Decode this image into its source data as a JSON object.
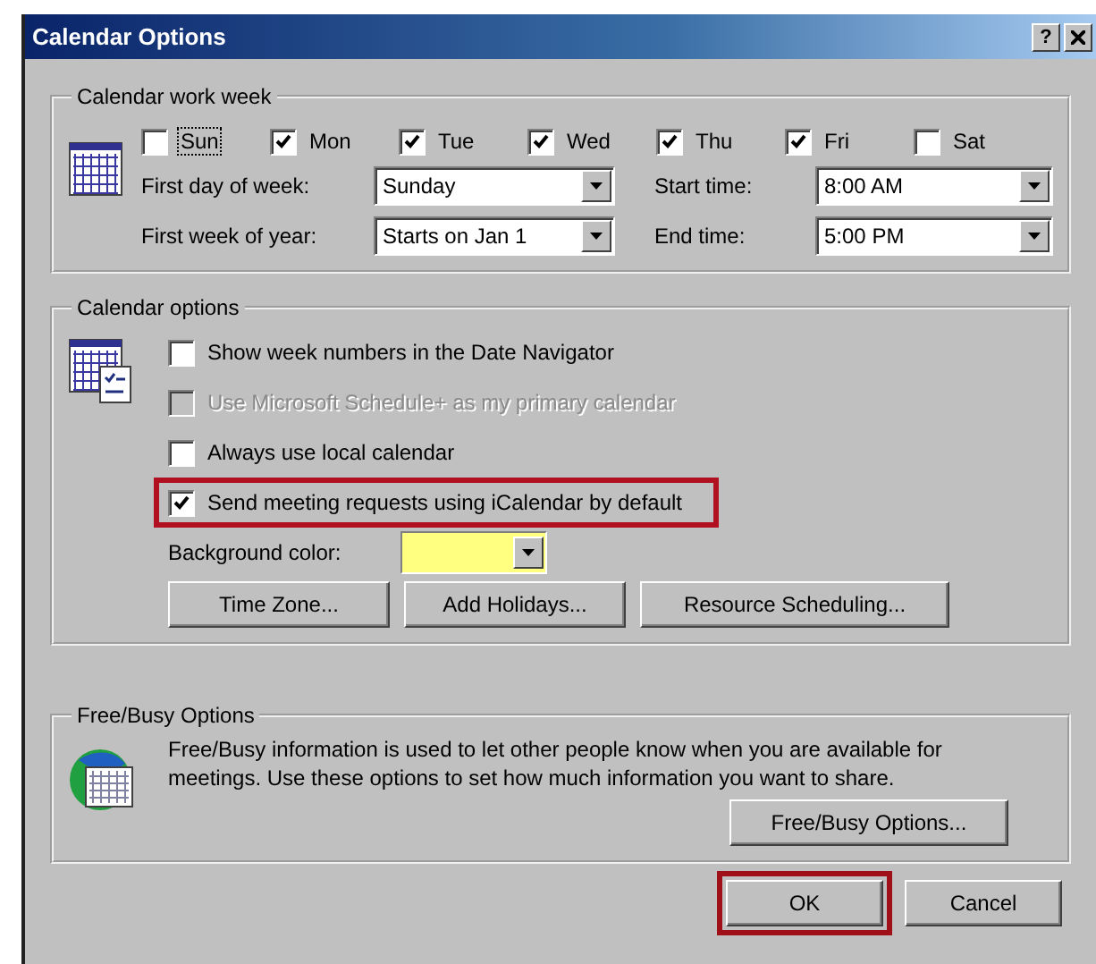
{
  "window": {
    "title": "Calendar Options",
    "help": "?"
  },
  "work_week": {
    "label": "Calendar work week",
    "days": [
      {
        "label": "Sun",
        "checked": false,
        "focused": true
      },
      {
        "label": "Mon",
        "checked": true,
        "focused": false
      },
      {
        "label": "Tue",
        "checked": true,
        "focused": false
      },
      {
        "label": "Wed",
        "checked": true,
        "focused": false
      },
      {
        "label": "Thu",
        "checked": true,
        "focused": false
      },
      {
        "label": "Fri",
        "checked": true,
        "focused": false
      },
      {
        "label": "Sat",
        "checked": false,
        "focused": false
      }
    ],
    "fields": [
      {
        "label": "First day of week:",
        "value": "Sunday"
      },
      {
        "label": "Start time:",
        "value": "8:00 AM"
      },
      {
        "label": "First week of year:",
        "value": "Starts on Jan 1"
      },
      {
        "label": "End time:",
        "value": "5:00 PM"
      }
    ]
  },
  "calendar_options": {
    "label": "Calendar options",
    "checkboxes": [
      {
        "label": "Show week numbers in the Date Navigator",
        "checked": false,
        "disabled": false,
        "highlighted": false
      },
      {
        "label": "Use Microsoft Schedule+ as my primary calendar",
        "checked": false,
        "disabled": true,
        "highlighted": false
      },
      {
        "label": "Always use local calendar",
        "checked": false,
        "disabled": false,
        "highlighted": false
      },
      {
        "label": "Send meeting requests using iCalendar by default",
        "checked": true,
        "disabled": false,
        "highlighted": true
      }
    ],
    "background_color": {
      "label": "Background color:",
      "color": "#ffff80"
    },
    "buttons": [
      "Time Zone...",
      "Add Holidays...",
      "Resource Scheduling..."
    ]
  },
  "free_busy": {
    "label": "Free/Busy Options",
    "description": "Free/Busy information is used to let other people know when you are available for meetings.  Use these options to set how much information you want to share.",
    "button": "Free/Busy Options..."
  },
  "footer_buttons": [
    {
      "label": "OK",
      "highlighted": true
    },
    {
      "label": "Cancel",
      "highlighted": false
    }
  ]
}
